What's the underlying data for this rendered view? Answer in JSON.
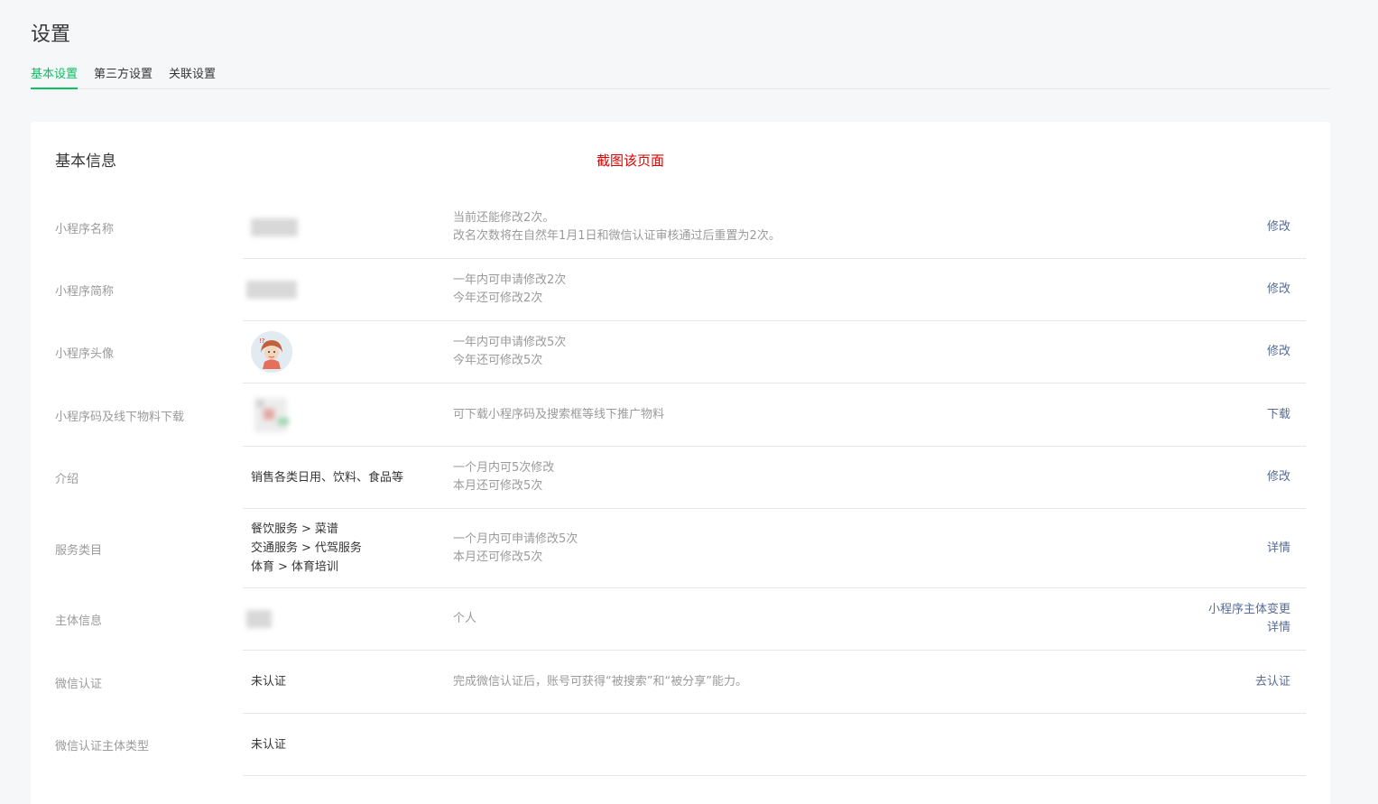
{
  "page": {
    "title": "设置"
  },
  "tabs": [
    {
      "label": "基本设置",
      "active": true
    },
    {
      "label": "第三方设置",
      "active": false
    },
    {
      "label": "关联设置",
      "active": false
    }
  ],
  "card": {
    "title": "基本信息",
    "note": "截图该页面",
    "note_color": "#e00000"
  },
  "rows": {
    "name": {
      "label": "小程序名称",
      "desc": [
        "当前还能修改2次。",
        "改名次数将在自然年1月1日和微信认证审核通过后重置为2次。"
      ],
      "action": "修改"
    },
    "short_name": {
      "label": "小程序简称",
      "desc": [
        "一年内可申请修改2次",
        "今年还可修改2次"
      ],
      "action": "修改"
    },
    "avatar": {
      "label": "小程序头像",
      "icon": "avatar-image",
      "desc": [
        "一年内可申请修改5次",
        "今年还可修改5次"
      ],
      "action": "修改"
    },
    "qrcode": {
      "label": "小程序码及线下物料下载",
      "icon": "qrcode-image",
      "desc": [
        "可下载小程序码及搜索框等线下推广物料"
      ],
      "action": "下载"
    },
    "intro": {
      "label": "介绍",
      "value": "销售各类日用、饮料、食品等",
      "desc": [
        "一个月内可5次修改",
        "本月还可修改5次"
      ],
      "action": "修改"
    },
    "category": {
      "label": "服务类目",
      "items": [
        {
          "main": "餐饮服务",
          "sub": "菜谱"
        },
        {
          "main": "交通服务",
          "sub": "代驾服务"
        },
        {
          "main": "体育",
          "sub": "体育培训"
        }
      ],
      "separator": ">",
      "desc": [
        "一个月内可申请修改5次",
        "本月还可修改5次"
      ],
      "action": "详情"
    },
    "entity": {
      "label": "主体信息",
      "desc": [
        "个人"
      ],
      "actions": [
        "小程序主体变更",
        "详情"
      ]
    },
    "verify": {
      "label": "微信认证",
      "value": "未认证",
      "desc": [
        "完成微信认证后，账号可获得“被搜索”和“被分享”能力。"
      ],
      "action": "去认证"
    },
    "verify_type": {
      "label": "微信认证主体类型",
      "value": "未认证"
    }
  },
  "colors": {
    "accent": "#07c160",
    "link": "#576b95",
    "muted": "#9a9a9a"
  }
}
